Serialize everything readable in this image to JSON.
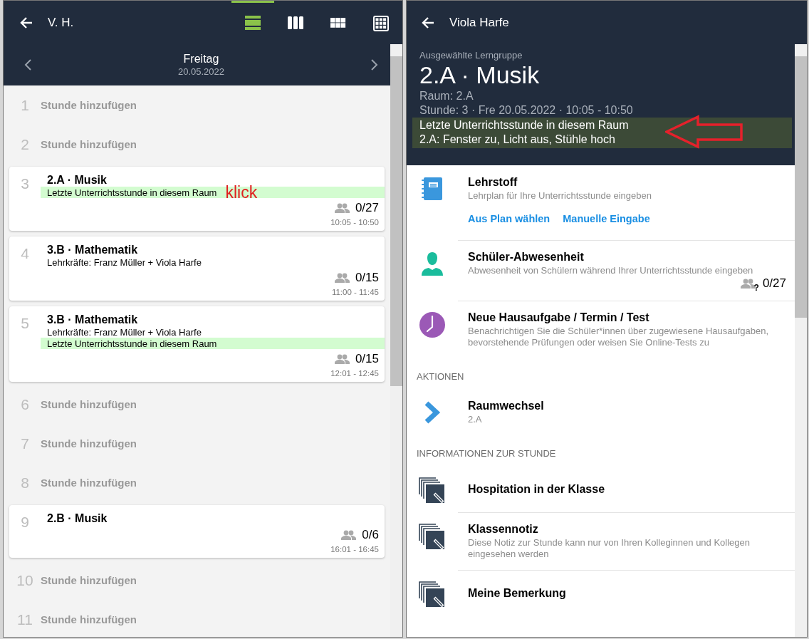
{
  "schedule": {
    "title": "V. H.",
    "view_buttons": [
      {
        "kind": "rows",
        "selected": true
      },
      {
        "kind": "columns",
        "selected": false
      },
      {
        "kind": "grid",
        "selected": false
      },
      {
        "kind": "grid-large",
        "selected": false
      }
    ],
    "day": {
      "weekday": "Freitag",
      "date": "20.05.2022"
    },
    "slots": [
      {
        "number": "1",
        "kind": "empty",
        "label": "Stunde hinzufügen"
      },
      {
        "number": "2",
        "kind": "empty",
        "label": "Stunde hinzufügen"
      },
      {
        "number": "3",
        "kind": "lesson",
        "title": "2.A · Musik",
        "lines": [
          {
            "text": "Letzte Unterrichtsstunde in diesem Raum",
            "highlighted": true,
            "annotation": "klick"
          }
        ],
        "count": "0/27",
        "time": "10:05 - 10:50"
      },
      {
        "number": "4",
        "kind": "lesson",
        "title": "3.B · Mathematik",
        "lines": [
          {
            "text": "Lehrkräfte: Franz Müller + Viola Harfe",
            "highlighted": false
          }
        ],
        "count": "0/15",
        "time": "11:00 - 11:45"
      },
      {
        "number": "5",
        "kind": "lesson",
        "title": "3.B · Mathematik",
        "lines": [
          {
            "text": "Lehrkräfte: Franz Müller + Viola Harfe",
            "highlighted": false
          },
          {
            "text": "Letzte Unterrichtsstunde in diesem Raum",
            "highlighted": true
          }
        ],
        "count": "0/15",
        "time": "12:01 - 12:45"
      },
      {
        "number": "6",
        "kind": "empty",
        "label": "Stunde hinzufügen"
      },
      {
        "number": "7",
        "kind": "empty",
        "label": "Stunde hinzufügen"
      },
      {
        "number": "8",
        "kind": "empty",
        "label": "Stunde hinzufügen"
      },
      {
        "number": "9",
        "kind": "lesson",
        "title": "2.B · Musik",
        "count": "0/6",
        "time": "16:01 - 16:45"
      },
      {
        "number": "10",
        "kind": "empty",
        "label": "Stunde hinzufügen"
      },
      {
        "number": "11",
        "kind": "empty",
        "label": "Stunde hinzufügen"
      }
    ]
  },
  "details": {
    "title": "Viola Harfe",
    "group_label": "Ausgewählte Lerngruppe",
    "group": "2.A · Musik",
    "room": "Raum: 2.A",
    "lesson": "Stunde: 3 · Fre 20.05.2022 · 10:05 - 10:50",
    "notice": [
      "Letzte Unterrichtsstunde in diesem Raum",
      "2.A: Fenster zu, Licht aus, Stühle hoch"
    ],
    "sections": [
      {
        "items": [
          {
            "kind": "notebook",
            "title": "Lehrstoff",
            "description": "Lehrplan für Ihre Unterrichtsstunde eingeben",
            "links": [
              "Aus Plan wählen",
              "Manuelle Eingabe"
            ]
          },
          {
            "kind": "person",
            "title": "Schüler-Abwesenheit",
            "description": "Abwesenheit von Schülern während Ihrer Unterrichtsstunde eingeben",
            "count": "0/27",
            "count_mark": "?"
          },
          {
            "kind": "clock",
            "title": "Neue Hausaufgabe / Termin / Test",
            "description": "Benachrichtigen Sie die Schüler*innen über zugewiesene Hausaufgaben, bevorstehende Prüfungen oder weisen Sie Online-Tests zu"
          }
        ]
      },
      {
        "heading": "AKTIONEN",
        "items": [
          {
            "kind": "chevron",
            "title": "Raumwechsel",
            "description": "2.A"
          }
        ]
      },
      {
        "heading": "INFORMATIONEN ZUR STUNDE",
        "items": [
          {
            "kind": "note",
            "title": "Hospitation in der Klasse"
          },
          {
            "kind": "note",
            "title": "Klassennotiz",
            "description": "Diese Notiz zur Stunde kann nur von Ihren Kolleginnen und Kollegen eingesehen werden"
          },
          {
            "kind": "note",
            "title": "Meine Bemerkung"
          }
        ]
      }
    ]
  }
}
